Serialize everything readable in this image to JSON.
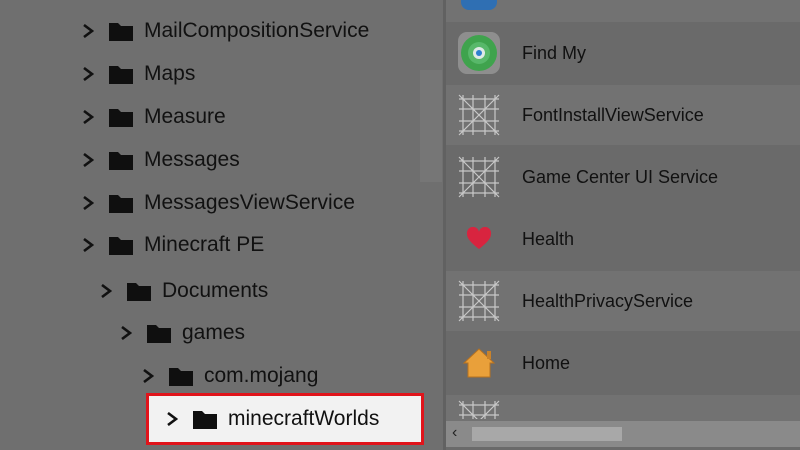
{
  "tree": {
    "items": [
      {
        "label": "MailCompositionService",
        "level": 0
      },
      {
        "label": "Maps",
        "level": 0
      },
      {
        "label": "Measure",
        "level": 0
      },
      {
        "label": "Messages",
        "level": 0
      },
      {
        "label": "MessagesViewService",
        "level": 0
      },
      {
        "label": "Minecraft PE",
        "level": 0
      },
      {
        "label": "Documents",
        "level": 1
      },
      {
        "label": "games",
        "level": 2
      },
      {
        "label": "com.mojang",
        "level": 3
      },
      {
        "label": "minecraftWorlds",
        "level": 4,
        "selected": true
      }
    ]
  },
  "apps": {
    "items": [
      {
        "label": "Find My",
        "icon": "find-my-icon"
      },
      {
        "label": "FontInstallViewService",
        "icon": "placeholder-grid-icon"
      },
      {
        "label": "Game Center UI Service",
        "icon": "placeholder-grid-icon"
      },
      {
        "label": "Health",
        "icon": "heart-icon"
      },
      {
        "label": "HealthPrivacyService",
        "icon": "placeholder-grid-icon"
      },
      {
        "label": "Home",
        "icon": "home-icon"
      }
    ]
  },
  "colors": {
    "highlight_border": "#e0141b",
    "heart": "#d8243f",
    "home": "#e9a03a",
    "find_my_green": "#3fa34d"
  }
}
